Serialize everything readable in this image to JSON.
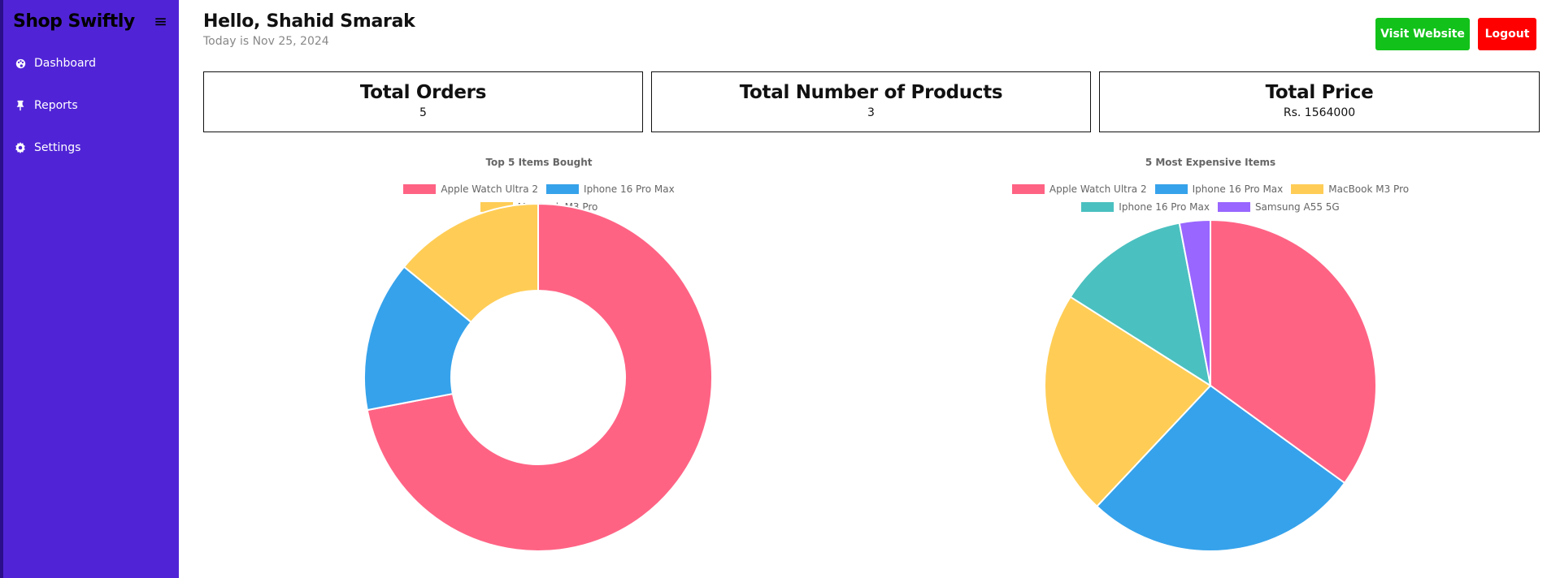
{
  "sidebar": {
    "brand": "Shop Swiftly",
    "items": [
      {
        "label": "Dashboard",
        "icon": "palette-icon"
      },
      {
        "label": "Reports",
        "icon": "pin-icon"
      },
      {
        "label": "Settings",
        "icon": "gear-icon"
      }
    ]
  },
  "header": {
    "greeting": "Hello, Shahid Smarak",
    "date": "Today is Nov 25, 2024",
    "visit_label": "Visit Website",
    "logout_label": "Logout"
  },
  "stats": [
    {
      "title": "Total Orders",
      "value": "5"
    },
    {
      "title": "Total Number of Products",
      "value": "3"
    },
    {
      "title": "Total Price",
      "value": "Rs. 1564000"
    }
  ],
  "colors": {
    "sidebar": "#5024d6",
    "visit": "#12c21a",
    "logout": "#ff0000"
  },
  "chart_data": [
    {
      "type": "doughnut",
      "title": "Top 5 Items Bought",
      "categories": [
        "Apple Watch Ultra 2",
        "Iphone 16 Pro Max",
        "MacBook M3 Pro"
      ],
      "values": [
        72,
        14,
        14
      ],
      "colors": [
        "#ff6384",
        "#36a2eb",
        "#ffcd56"
      ],
      "legend": "top"
    },
    {
      "type": "pie",
      "title": "5 Most Expensive Items",
      "categories": [
        "Apple Watch Ultra 2",
        "Iphone 16 Pro Max",
        "MacBook M3 Pro",
        "Iphone 16 Pro Max",
        "Samsung A55 5G"
      ],
      "values": [
        35,
        27,
        22,
        13,
        3
      ],
      "colors": [
        "#ff6384",
        "#36a2eb",
        "#ffcd56",
        "#4bc0c0",
        "#9966ff"
      ],
      "legend": "top"
    }
  ]
}
